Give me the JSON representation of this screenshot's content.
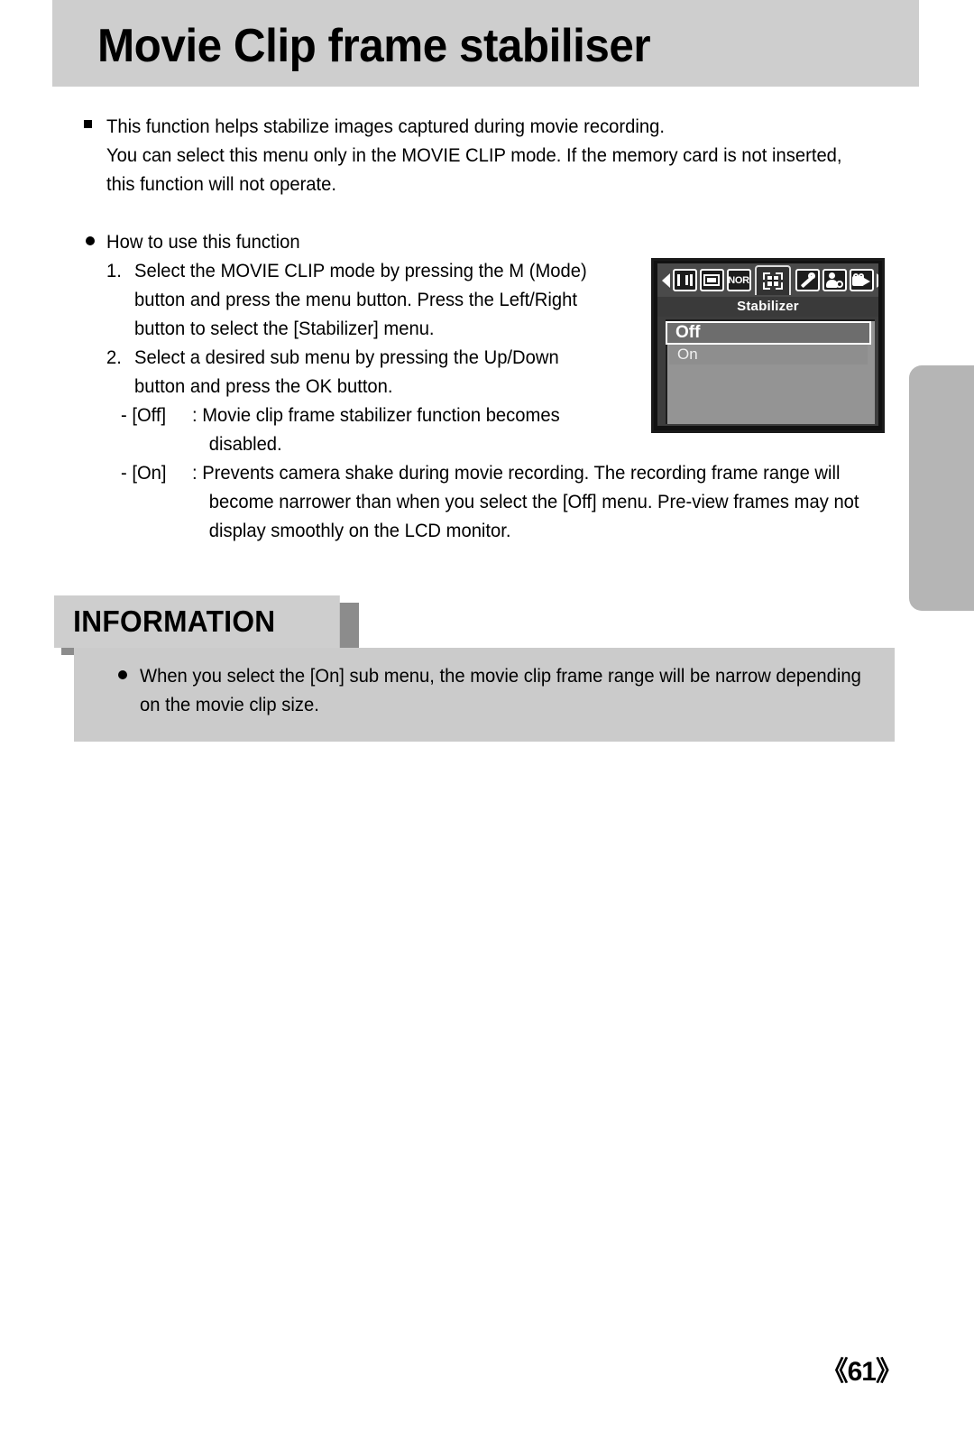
{
  "header": {
    "title": "Movie Clip frame stabiliser"
  },
  "intro": {
    "bullet_icon": "square-bullet",
    "lines": [
      "This function helps stabilize images captured during movie recording.",
      "You can select this menu only in the MOVIE CLIP mode. If the memory card is not inserted,",
      "this function will not operate."
    ]
  },
  "howto": {
    "bullet_icon": "round-bullet",
    "label": "How to use this function",
    "steps": [
      {
        "number": "1.",
        "lines": [
          "Select the MOVIE CLIP mode by pressing the M (Mode)",
          "button and press the menu button. Press the Left/Right",
          "button to select the [Stabilizer] menu."
        ]
      },
      {
        "number": "2.",
        "lines": [
          "Select a desired sub menu by pressing the Up/Down",
          "button and press the OK button."
        ]
      }
    ],
    "options": [
      {
        "key": "- [Off]",
        "lines": [
          ": Movie clip frame stabilizer function becomes",
          "disabled."
        ]
      },
      {
        "key": "- [On]",
        "lines": [
          ": Prevents camera shake during movie recording. The recording frame range will",
          "become narrower than when you select the [Off] menu. Pre-view frames may not",
          "display smoothly on the LCD monitor."
        ]
      }
    ]
  },
  "lcd": {
    "nav_left_icon": "triangle-left-icon",
    "nav_right_icon": "triangle-right-icon",
    "tabs": [
      {
        "icon": "display-info-icon",
        "label": ""
      },
      {
        "icon": "image-frame-icon",
        "label": ""
      },
      {
        "icon": "quality-normal-icon",
        "label": "NOR"
      },
      {
        "icon": "stabilizer-icon",
        "label": "",
        "selected": true
      },
      {
        "icon": "wrench-setup-icon",
        "label": ""
      },
      {
        "icon": "user-setting-icon",
        "label": ""
      },
      {
        "icon": "movie-camera-icon",
        "label": ""
      }
    ],
    "menu_title": "Stabilizer",
    "menu_items": [
      {
        "label": "Off",
        "selected": true
      },
      {
        "label": "On",
        "selected": false
      }
    ]
  },
  "information": {
    "label": "INFORMATION",
    "bullet_icon": "round-bullet",
    "lines": [
      "When you select the [On] sub menu, the movie clip frame range will be narrow depending",
      "on the movie clip size."
    ]
  },
  "footer": {
    "page_number": "《61》"
  },
  "colors": {
    "banner": "#cecece",
    "info_box": "#cbcbcb",
    "info_shadow": "#8c8c8c",
    "edge_tab": "#b5b5b5",
    "lcd_bg": "#949494",
    "lcd_selected": "#6d6d6d"
  }
}
